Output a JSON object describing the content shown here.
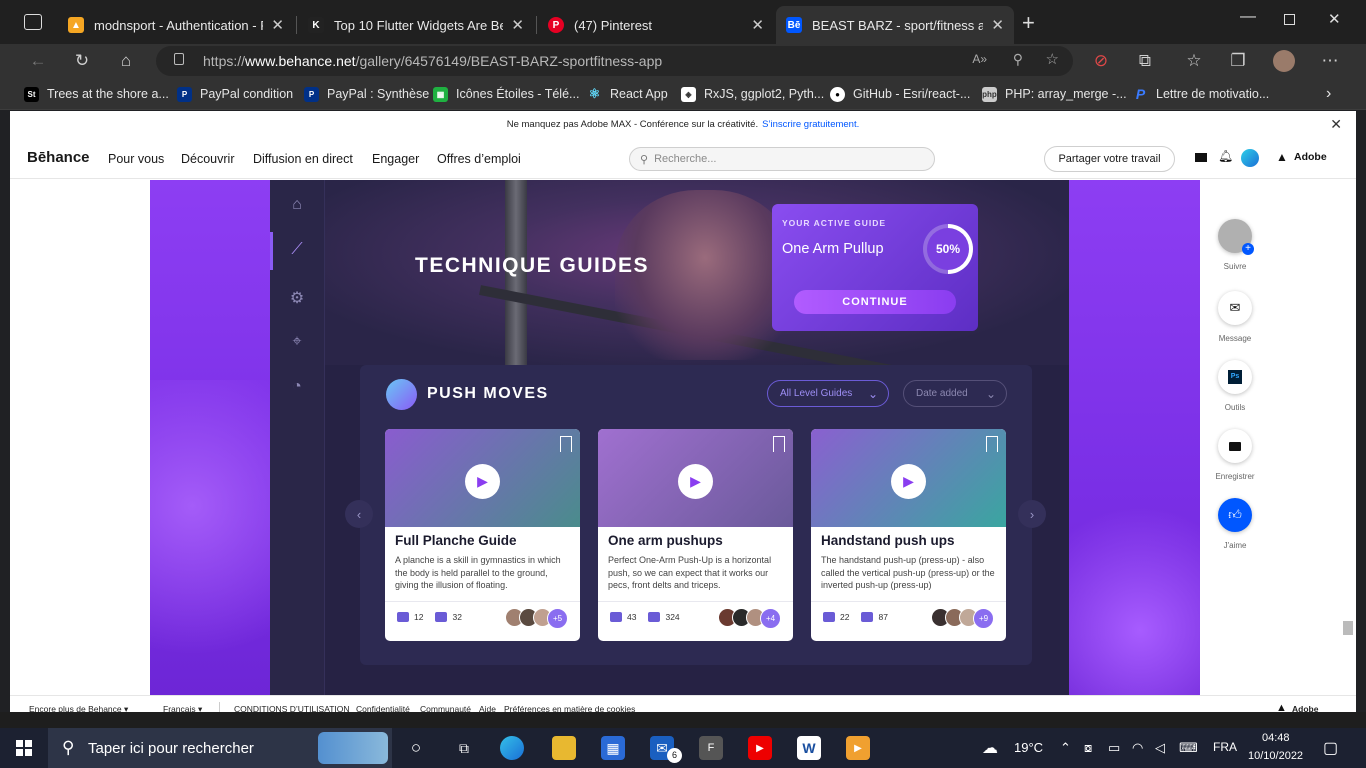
{
  "tabs": [
    {
      "title": "modnsport - Authentication - Fir",
      "active": false
    },
    {
      "title": "Top 10 Flutter Widgets Are Best",
      "active": false
    },
    {
      "title": "(47) Pinterest",
      "active": false
    },
    {
      "title": "BEAST BARZ - sport/fitness app c",
      "active": true
    }
  ],
  "address": {
    "prefix": "https://",
    "domain": "www.behance.net",
    "path": "/gallery/64576149/BEAST-BARZ-sportfitness-app"
  },
  "bookmarks": [
    "Trees at the shore a...",
    "PayPal condition",
    "PayPal : Synthèse",
    "Icônes Étoiles - Télé...",
    "React App",
    "RxJS, ggplot2, Pyth...",
    "GitHub - Esri/react-...",
    "PHP: array_merge -...",
    "Lettre de motivatio..."
  ],
  "promo": {
    "text": "Ne manquez pas Adobe MAX - Conférence sur la créativité.",
    "link": "S’inscrire gratuitement."
  },
  "behance": {
    "logo": "Bēhance",
    "nav": [
      "Pour vous",
      "Découvrir",
      "Diffusion en direct",
      "Engager",
      "Offres d’emploi"
    ],
    "search_placeholder": "Recherche...",
    "share_label": "Partager votre travail",
    "adobe_label": "Adobe"
  },
  "app": {
    "hero_title": "TECHNIQUE GUIDES",
    "active_guide": {
      "label": "YOUR ACTIVE GUIDE",
      "name": "One Arm Pullup",
      "progress_text": "50%",
      "progress": 0.5,
      "button": "CONTINUE"
    },
    "section_title": "PUSH MOVES",
    "filter_level": "All Level Guides",
    "filter_date": "Date added",
    "cards": [
      {
        "title": "Full Planche Guide",
        "desc": "A planche is a skill in gymnastics in which the body is held parallel to the ground, giving the illusion of floating.",
        "comments": "12",
        "likes": "32",
        "more": "+5"
      },
      {
        "title": "One arm pushups",
        "desc": "Perfect One-Arm Push-Up is a horizontal push, so we can expect that it works our pecs, front delts and triceps.",
        "comments": "43",
        "likes": "324",
        "more": "+4"
      },
      {
        "title": "Handstand push ups",
        "desc": "The handstand push-up (press-up) - also called the vertical push-up (press-up) or the inverted push-up (press-up)",
        "comments": "22",
        "likes": "87",
        "more": "+9"
      }
    ]
  },
  "rail": [
    {
      "label": "Suivre",
      "icon": "avatar-icon"
    },
    {
      "label": "Message",
      "icon": "mail-icon"
    },
    {
      "label": "Outils",
      "icon": "photoshop-icon"
    },
    {
      "label": "Enregistrer",
      "icon": "folder-icon"
    },
    {
      "label": "J'aime",
      "icon": "thumbs-up-icon"
    }
  ],
  "footer": {
    "more": "Encore plus de Behance ▾",
    "lang": "Français ▾",
    "links": [
      "CONDITIONS D’UTILISATION",
      "Confidentialité",
      "Communauté",
      "Aide",
      "Préférences en matière de cookies"
    ],
    "adobe": "Adobe"
  },
  "taskbar": {
    "search_placeholder": "Taper ici pour rechercher",
    "mail_badge": "6",
    "weather": "19°C",
    "lang": "FRA",
    "time": "04:48",
    "date": "10/10/2022"
  },
  "colors": {
    "accent": "#8a3df0",
    "behance_blue": "#0057ff",
    "panel": "#262244"
  }
}
